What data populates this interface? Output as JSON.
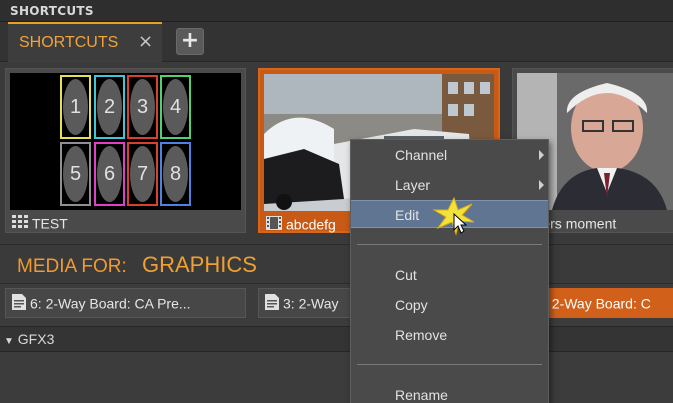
{
  "panel": {
    "title": "SHORTCUTS"
  },
  "tabs": [
    {
      "label": "SHORTCUTS",
      "close_symbol": "×"
    }
  ],
  "add_tab_symbol": "+",
  "shortcuts": [
    {
      "caption": "TEST",
      "icon": "grid-icon",
      "cells": [
        "1",
        "2",
        "3",
        "4",
        "5",
        "6",
        "7",
        "8"
      ]
    },
    {
      "caption": "abcdefg",
      "icon": "film-icon"
    },
    {
      "caption": "anders moment",
      "icon": "film-icon"
    }
  ],
  "grid_colors": [
    "#e8e050",
    "#3cc8d8",
    "#d84030",
    "#50d070",
    "#909090",
    "#e040c8",
    "#d84030",
    "#5080e0"
  ],
  "media": {
    "prefix": "MEDIA FOR:",
    "name": "GRAPHICS",
    "items": [
      {
        "label": "6: 2-Way Board: CA   Pre..."
      },
      {
        "label": "3: 2-Way"
      },
      {
        "label": ": 2-Way Board: C"
      }
    ]
  },
  "section": {
    "label": "GFX3",
    "toggle_symbol": "▼"
  },
  "context_menu": {
    "items": [
      {
        "label": "Channel",
        "submenu": true
      },
      {
        "label": "Layer",
        "submenu": true
      },
      {
        "label": "Edit",
        "highlighted": true
      },
      {
        "label": "Cut"
      },
      {
        "label": "Copy"
      },
      {
        "label": "Remove"
      },
      {
        "label": "Rename"
      }
    ]
  },
  "colors": {
    "accent": "#f2a33a",
    "selected_tile": "#c85a16",
    "menu_highlight": "#5f7592"
  }
}
